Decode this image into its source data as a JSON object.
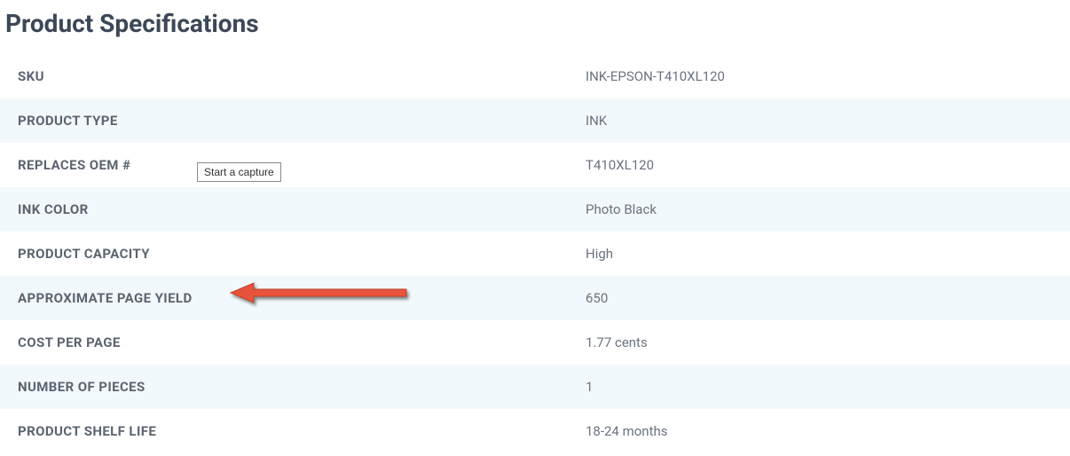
{
  "heading": "Product Specifications",
  "specs": [
    {
      "label": "SKU",
      "value": "INK-EPSON-T410XL120"
    },
    {
      "label": "PRODUCT TYPE",
      "value": "INK"
    },
    {
      "label": "REPLACES OEM #",
      "value": "T410XL120"
    },
    {
      "label": "INK COLOR",
      "value": "Photo Black"
    },
    {
      "label": "PRODUCT CAPACITY",
      "value": "High"
    },
    {
      "label": "APPROXIMATE PAGE YIELD",
      "value": "650"
    },
    {
      "label": "COST PER PAGE",
      "value": "1.77 cents"
    },
    {
      "label": "NUMBER OF PIECES",
      "value": "1"
    },
    {
      "label": "PRODUCT SHELF LIFE",
      "value": "18-24 months"
    }
  ],
  "tooltip": "Start a capture",
  "annotation": {
    "type": "arrow",
    "color": "#e8533a",
    "target_row": 5
  }
}
